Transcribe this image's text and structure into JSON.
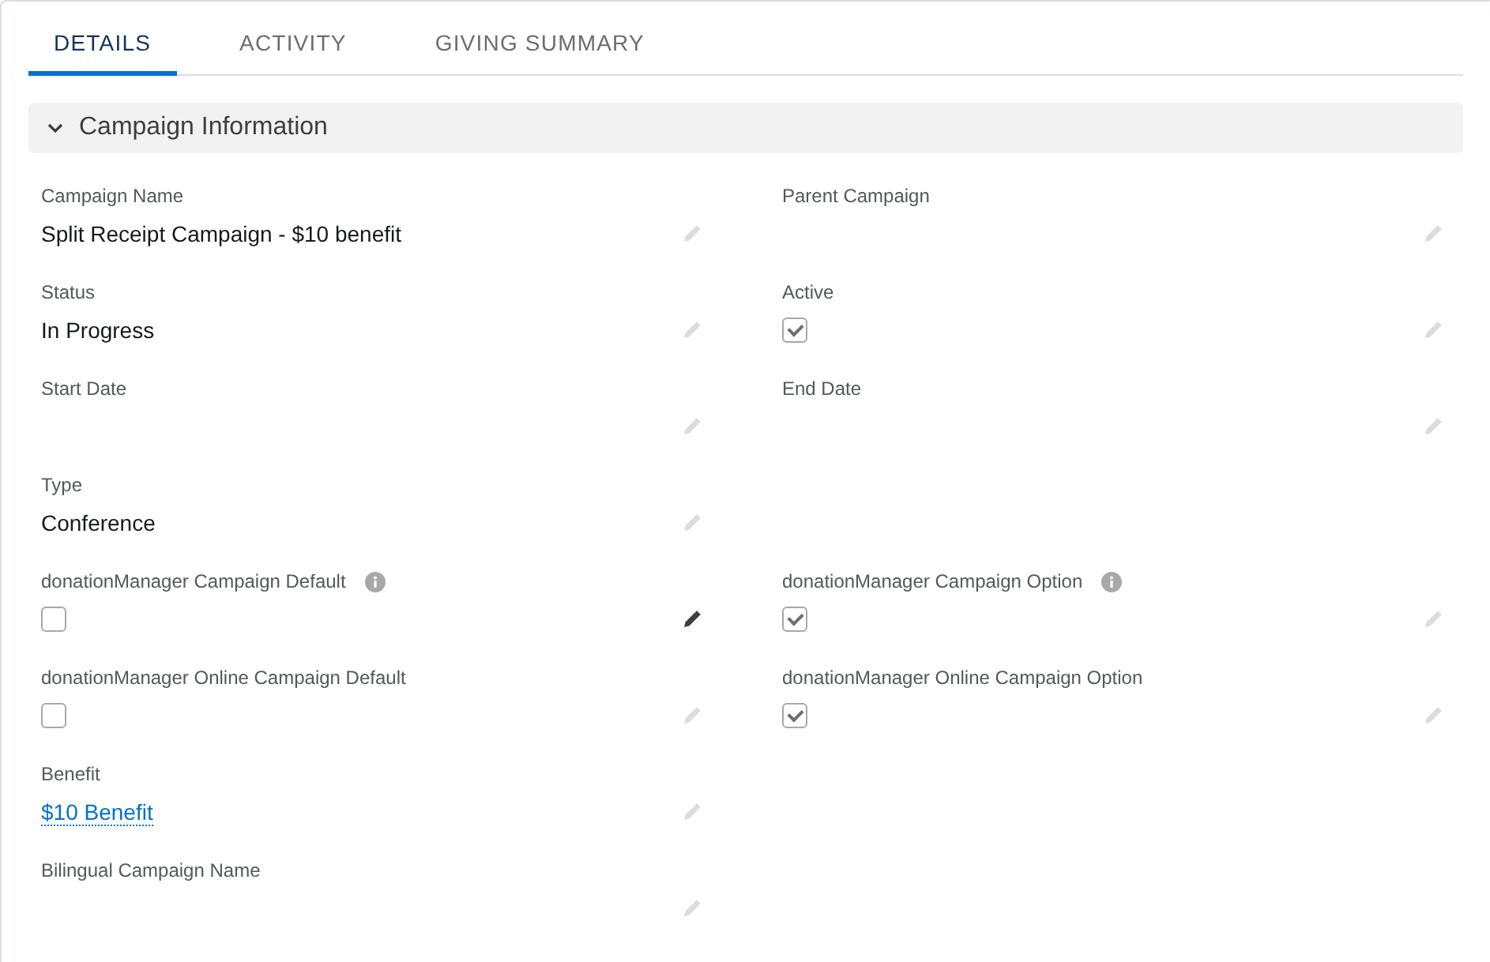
{
  "tabs": [
    {
      "label": "DETAILS",
      "selected": true
    },
    {
      "label": "ACTIVITY",
      "selected": false
    },
    {
      "label": "GIVING SUMMARY",
      "selected": false
    }
  ],
  "section": {
    "title": "Campaign Information",
    "expanded": true
  },
  "rows": [
    [
      {
        "kind": "text",
        "label": "Campaign Name",
        "value": "Split Receipt Campaign - $10 benefit",
        "info": false,
        "edit_active": false
      },
      {
        "kind": "text",
        "label": "Parent Campaign",
        "info": false,
        "edit_active": false
      }
    ],
    [
      {
        "kind": "text",
        "label": "Status",
        "value": "In Progress",
        "info": false,
        "edit_active": false
      },
      {
        "kind": "checkbox",
        "label": "Active",
        "checked": true,
        "info": false,
        "edit_active": false
      }
    ],
    [
      {
        "kind": "text",
        "label": "Start Date",
        "info": false,
        "edit_active": false
      },
      {
        "kind": "text",
        "label": "End Date",
        "info": false,
        "edit_active": false
      }
    ],
    [
      {
        "kind": "text",
        "label": "Type",
        "value": "Conference",
        "info": false,
        "edit_active": false
      },
      {
        "kind": "blank"
      }
    ],
    [
      {
        "kind": "checkbox",
        "label": "donationManager Campaign Default",
        "checked": false,
        "info": true,
        "edit_active": true
      },
      {
        "kind": "checkbox",
        "label": "donationManager Campaign Option",
        "checked": true,
        "info": true,
        "edit_active": false
      }
    ],
    [
      {
        "kind": "checkbox",
        "label": "donationManager Online Campaign Default",
        "checked": false,
        "info": false,
        "edit_active": false
      },
      {
        "kind": "checkbox",
        "label": "donationManager Online Campaign Option",
        "checked": true,
        "info": false,
        "edit_active": false
      }
    ],
    [
      {
        "kind": "link",
        "label": "Benefit",
        "value": "$10 Benefit",
        "info": false,
        "edit_active": false
      },
      {
        "kind": "blank"
      }
    ],
    [
      {
        "kind": "text",
        "label": "Bilingual Campaign Name",
        "info": false,
        "edit_active": false
      },
      {
        "kind": "blank"
      }
    ]
  ]
}
